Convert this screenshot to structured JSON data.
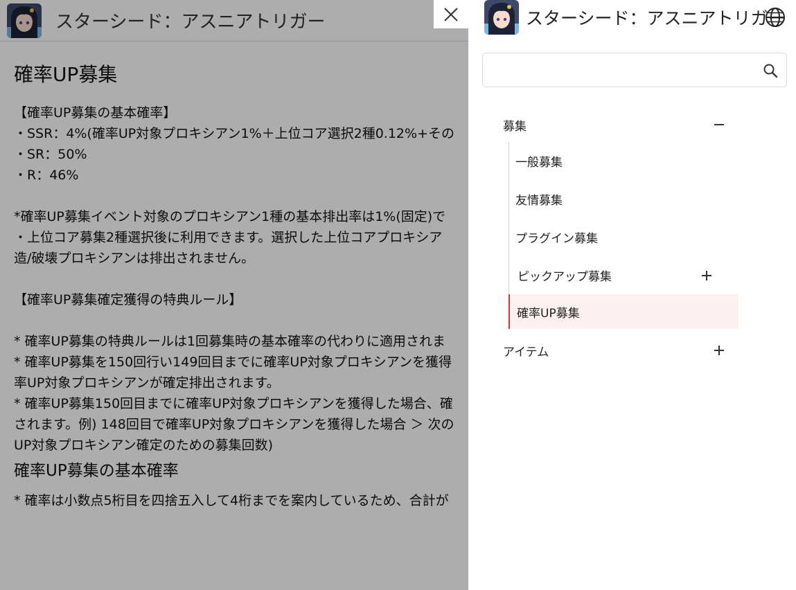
{
  "site_title": "スターシード：アスニアトリガー",
  "article": {
    "heading": "確率UP募集",
    "lines": [
      "【確率UP募集の基本確率】",
      "・SSR：4%(確率UP対象プロキシアン1%＋上位コア選択2種0.12%+その",
      "・SR：50%",
      "・R：46%",
      "",
      "*確率UP募集イベント対象のプロキシアン1種の基本排出率は1%(固定)で",
      "・上位コア募集2種選択後に利用できます。選択した上位コアプロキシア",
      "造/破壊プロキシアンは排出されません。",
      "",
      "【確率UP募集確定獲得の特典ルール】",
      "",
      "* 確率UP募集の特典ルールは1回募集時の基本確率の代わりに適用されま",
      "* 確率UP募集を150回行い149回目までに確率UP対象プロキシアンを獲得",
      "率UP対象プロキシアンが確定排出されます。",
      "* 確率UP募集150回目までに確率UP対象プロキシアンを獲得した場合、確",
      "されます。例) 148回目で確率UP対象プロキシアンを獲得した場合 ＞ 次の",
      "UP対象プロキシアン確定のための募集回数)"
    ],
    "subheading": "確率UP募集の基本確率",
    "note": "* 確率は小数点5桁目を四捨五入して4桁までを案内しているため、合計が"
  },
  "drawer": {
    "search_placeholder": "",
    "categories": [
      {
        "label": "募集",
        "expanded": true,
        "items": [
          {
            "label": "一般募集"
          },
          {
            "label": "友情募集"
          },
          {
            "label": "プラグイン募集"
          },
          {
            "label": "ピックアップ募集"
          },
          {
            "label": "確率UP募集"
          }
        ]
      },
      {
        "label": "アイテム",
        "expanded": false
      }
    ]
  },
  "colors": {
    "accent": "#c83a3a",
    "active_bg": "#fdf0f0",
    "overlay": "rgba(0,0,0,0.32)"
  },
  "icons": {
    "close": "close-icon",
    "globe": "globe-icon",
    "search": "search-icon",
    "collapse": "minus-icon",
    "expand": "plus-icon"
  }
}
